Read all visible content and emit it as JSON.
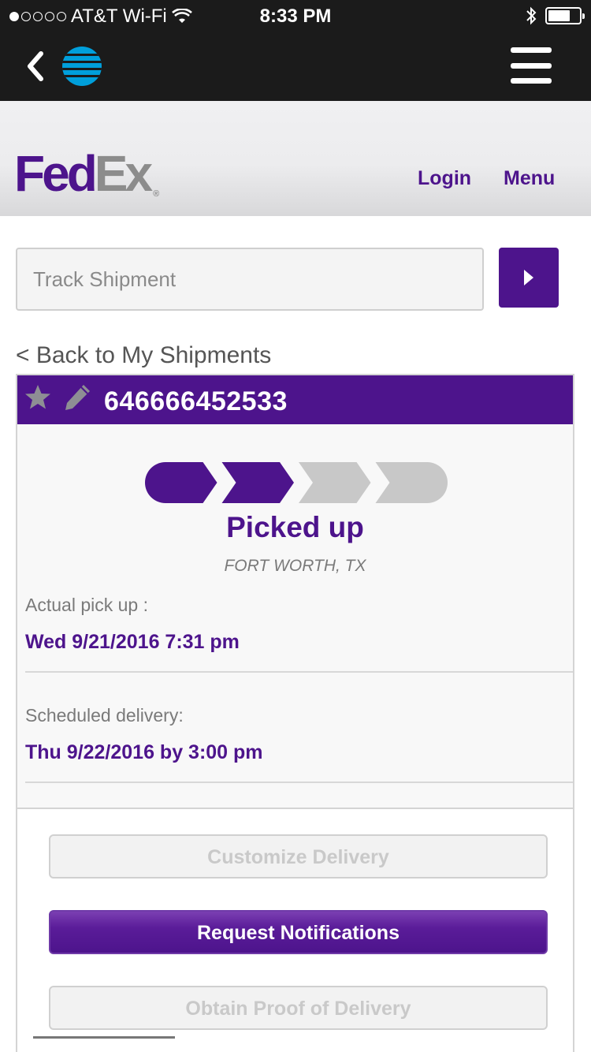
{
  "status_bar": {
    "carrier": "AT&T Wi-Fi",
    "time": "8:33 PM",
    "battery_level": 0.7
  },
  "app_bar": {
    "back_icon": "chevron-left-icon",
    "logo": "att-globe-logo",
    "menu_icon": "hamburger-icon"
  },
  "header": {
    "logo_fed": "Fed",
    "logo_ex": "Ex",
    "logo_mark": "®",
    "login_label": "Login",
    "menu_label": "Menu"
  },
  "track": {
    "placeholder": "Track Shipment",
    "value": "",
    "go_icon": "play-arrow-icon"
  },
  "back_link": "< Back to My Shipments",
  "shipment": {
    "tracking_number": "646666452533",
    "star_icon": "star-icon",
    "edit_icon": "pencil-icon",
    "progress": {
      "total_steps": 4,
      "completed_steps": 2
    },
    "status": "Picked up",
    "location": "FORT WORTH, TX",
    "pickup_label": "Actual pick up :",
    "pickup_value": "Wed 9/21/2016 7:31 pm",
    "delivery_label": "Scheduled delivery:",
    "delivery_value": "Thu 9/22/2016 by 3:00 pm"
  },
  "actions": {
    "customize": "Customize Delivery",
    "notifications": "Request Notifications",
    "proof": "Obtain Proof of Delivery"
  },
  "colors": {
    "brand_purple": "#4d148c",
    "brand_gray": "#8c8c8c",
    "progress_inactive": "#c8c8c8"
  }
}
